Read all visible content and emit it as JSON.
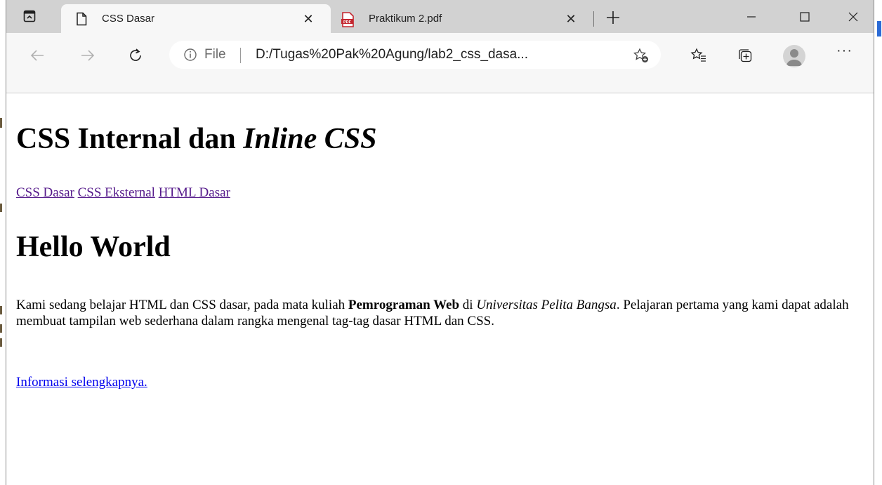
{
  "tabs": [
    {
      "title": "CSS Dasar",
      "icon": "page-icon",
      "active": true
    },
    {
      "title": "Praktikum 2.pdf",
      "icon": "pdf-icon",
      "active": false
    }
  ],
  "address_bar": {
    "scheme_label": "File",
    "url": "D:/Tugas%20Pak%20Agung/lab2_css_dasa..."
  },
  "page": {
    "title_part1": "CSS Internal dan ",
    "title_part2": "Inline CSS",
    "nav_links": [
      "CSS Dasar",
      "CSS Eksternal",
      "HTML Dasar"
    ],
    "heading2": "Hello World",
    "para_part1": "Kami sedang belajar HTML dan CSS dasar, pada mata kuliah ",
    "para_bold": "Pemrograman Web",
    "para_part2": " di ",
    "para_italic": "Universitas Pelita Bangsa",
    "para_part3": ". Pelajaran pertama yang kami dapat adalah membuat tampilan web sederhana dalam rangka mengenal tag-tag dasar HTML dan CSS.",
    "more_link": "Informasi selengkapnya."
  },
  "colors": {
    "visited_link": "#551a8b",
    "link": "#0000ee",
    "tabstrip": "#d2d2d2",
    "toolbar": "#f7f7f7"
  }
}
